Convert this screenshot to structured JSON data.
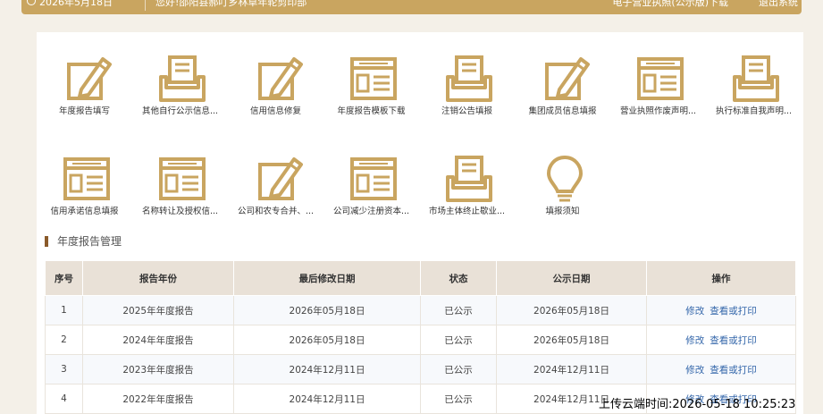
{
  "topbar": {
    "date": "2026年5月18日",
    "welcome": "您好!邵阳县郝叮乡林草年轮剪印部",
    "license_link": "电子营业执照(公示版)下载",
    "logout": "退出系统"
  },
  "tiles": [
    {
      "label": "年度报告填写",
      "icon": "pencil-doc-icon"
    },
    {
      "label": "其他自行公示信息...",
      "icon": "inbox-tray-icon"
    },
    {
      "label": "信用信息修复",
      "icon": "pencil-doc-icon"
    },
    {
      "label": "年度报告模板下载",
      "icon": "form-template-icon"
    },
    {
      "label": "注销公告填报",
      "icon": "inbox-tray-icon"
    },
    {
      "label": "集团成员信息填报",
      "icon": "pencil-doc-icon"
    },
    {
      "label": "营业执照作废声明...",
      "icon": "form-template-icon"
    },
    {
      "label": "执行标准自我声明...",
      "icon": "inbox-tray-icon"
    },
    {
      "label": "信用承诺信息填报",
      "icon": "form-template-icon"
    },
    {
      "label": "名称转让及授权信...",
      "icon": "form-template-icon"
    },
    {
      "label": "公司和农专合并、...",
      "icon": "pencil-doc-icon"
    },
    {
      "label": "公司减少注册资本...",
      "icon": "form-template-icon"
    },
    {
      "label": "市场主体终止歇业...",
      "icon": "inbox-tray-icon"
    },
    {
      "label": "填报须知",
      "icon": "lightbulb-icon"
    }
  ],
  "section": {
    "title": "年度报告管理"
  },
  "table": {
    "headers": [
      "序号",
      "报告年份",
      "最后修改日期",
      "状态",
      "公示日期",
      "操作"
    ],
    "rows": [
      {
        "no": "1",
        "year": "2025年年度报告",
        "modified": "2026年05月18日",
        "status": "已公示",
        "published": "2026年05月18日",
        "edit": "修改",
        "view": "查看或打印"
      },
      {
        "no": "2",
        "year": "2024年年度报告",
        "modified": "2026年05月18日",
        "status": "已公示",
        "published": "2026年05月18日",
        "edit": "修改",
        "view": "查看或打印"
      },
      {
        "no": "3",
        "year": "2023年年度报告",
        "modified": "2024年12月11日",
        "status": "已公示",
        "published": "2024年12月11日",
        "edit": "修改",
        "view": "查看或打印"
      },
      {
        "no": "4",
        "year": "2022年年度报告",
        "modified": "2024年12月11日",
        "status": "已公示",
        "published": "2024年12月11日",
        "edit": "修改",
        "view": "查看或打印"
      }
    ]
  },
  "watermark": "上传云端时间:2026-05-18 10:25:23",
  "colors": {
    "gold": "#c9a560",
    "header_bg": "#e9e1d7",
    "link": "#3366aa",
    "section_bar": "#8a5a2a"
  }
}
